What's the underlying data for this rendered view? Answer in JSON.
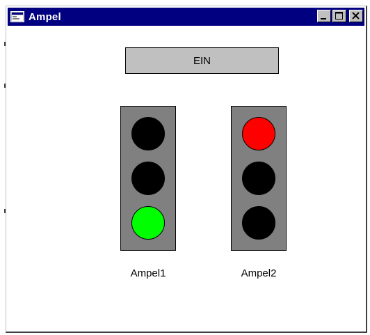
{
  "window": {
    "title": "Ampel",
    "icon": "app-window-icon",
    "controls": [
      "minimize",
      "maximize",
      "close"
    ]
  },
  "ein_button": {
    "label": "EIN"
  },
  "lights": [
    {
      "label": "Ampel1",
      "lamps": [
        "#000000",
        "#000000",
        "#00ff00"
      ]
    },
    {
      "label": "Ampel2",
      "lamps": [
        "#ff0000",
        "#000000",
        "#000000"
      ]
    }
  ],
  "colors": {
    "titlebar": "#000080",
    "red": "#ff0000",
    "green": "#00ff00",
    "off": "#000000",
    "housing": "#808080"
  }
}
